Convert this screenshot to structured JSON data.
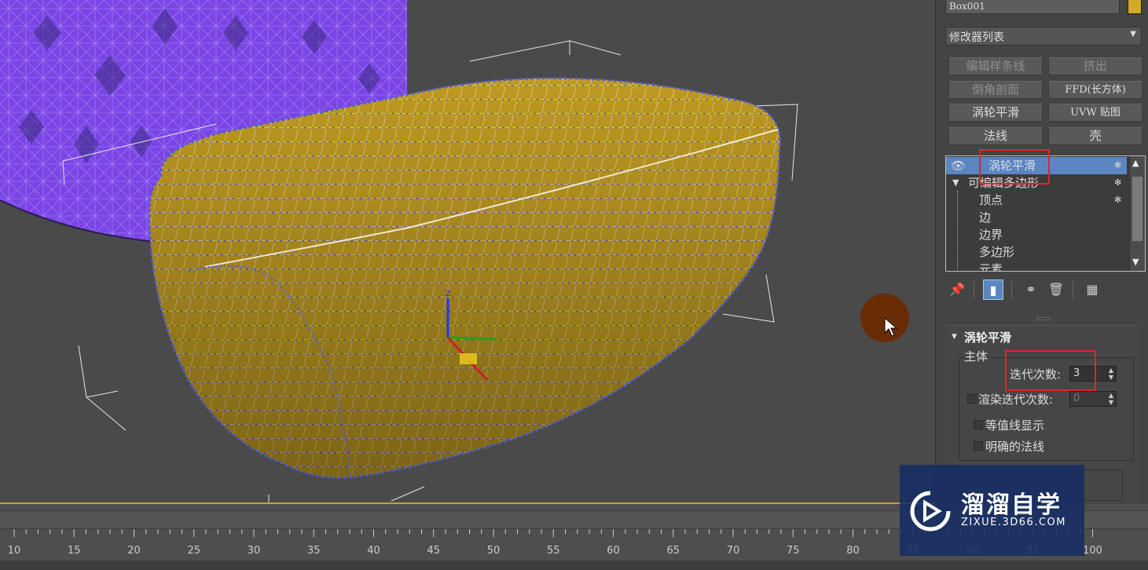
{
  "panel": {
    "object_name": "Box001",
    "object_color": "#d6a82a",
    "modifier_list": "修改器列表",
    "modifier_buttons": [
      {
        "label": "编辑样条线",
        "enabled": false
      },
      {
        "label": "挤出",
        "enabled": false
      },
      {
        "label": "倒角剖面",
        "enabled": false
      },
      {
        "label": "FFD(长方体)",
        "enabled": true
      },
      {
        "label": "涡轮平滑",
        "enabled": true
      },
      {
        "label": "UVW 贴图",
        "enabled": true
      },
      {
        "label": "法线",
        "enabled": true
      },
      {
        "label": "壳",
        "enabled": true
      }
    ],
    "stack": [
      {
        "label": "涡轮平滑",
        "selected": true
      },
      {
        "label": "可编辑多边形",
        "selected": false
      },
      {
        "label": "顶点",
        "selected": false
      },
      {
        "label": "边",
        "selected": false
      },
      {
        "label": "边界",
        "selected": false
      },
      {
        "label": "多边形",
        "selected": false
      },
      {
        "label": "元素",
        "selected": false
      }
    ],
    "rollout": {
      "title": "涡轮平滑",
      "group_main": "主体",
      "iterations_label": "迭代次数:",
      "iterations_value": "3",
      "render_iters_label": "渲染迭代次数:",
      "render_iters_value": "0",
      "isoline_label": "等值线显示",
      "explicit_normals_label": "明确的法线"
    }
  },
  "timeline": {
    "ticks": [
      "10",
      "15",
      "20",
      "25",
      "30",
      "35",
      "40",
      "45",
      "50",
      "55",
      "60",
      "65",
      "70",
      "75",
      "80",
      "85",
      "90",
      "95",
      "100"
    ]
  },
  "watermark": {
    "title": "溜溜自学",
    "subtitle": "ZIXUE.3D66.COM"
  },
  "colors": {
    "accent_selection": "#5b86c2",
    "highlight_box": "#e1242a",
    "object_yellow": "#c9a227",
    "wire_blue": "#4a5be0",
    "purple_object": "#7a3ee0"
  }
}
